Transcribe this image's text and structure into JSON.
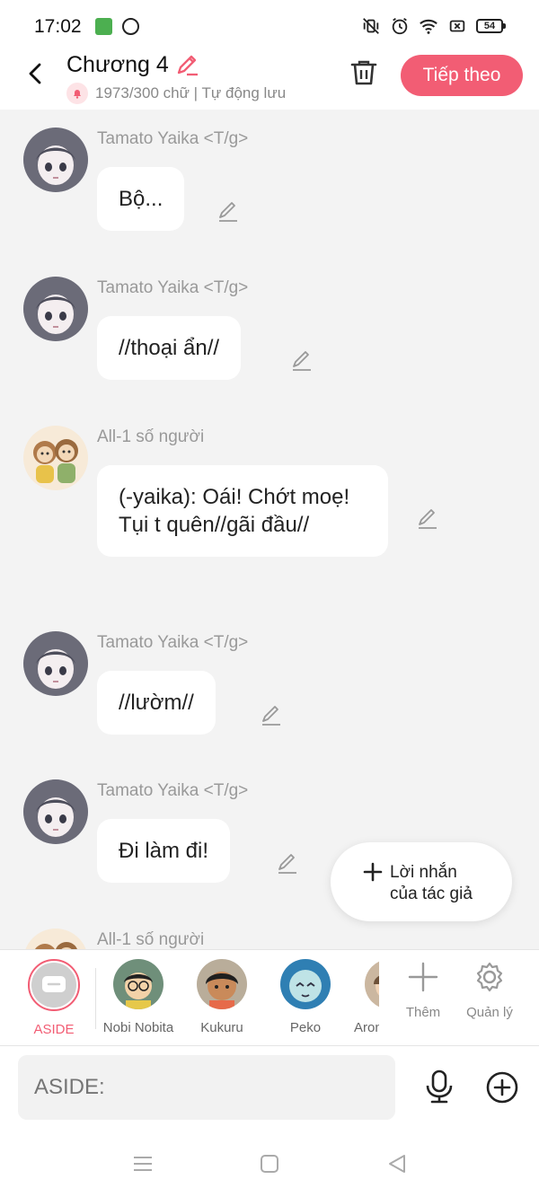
{
  "status_bar": {
    "time": "17:02",
    "battery": "54"
  },
  "header": {
    "title": "Chương 4",
    "subtitle": "1973/300 chữ | Tự động lưu",
    "next_label": "Tiếp theo"
  },
  "messages": [
    {
      "sender": "Tamato Yaika <T/g>",
      "text": "Bộ...",
      "avatar": "anime-girl"
    },
    {
      "sender": "Tamato Yaika <T/g>",
      "text": "//thoại ẩn//",
      "avatar": "anime-girl"
    },
    {
      "sender": "All-1 số người",
      "text": "(-yaika): Oái! Chớt moẹ! Tụi t quên//gãi đầu//",
      "avatar": "monkeys"
    },
    {
      "sender": "Tamato Yaika <T/g>",
      "text": "//lườm//",
      "avatar": "anime-girl"
    },
    {
      "sender": "Tamato Yaika <T/g>",
      "text": "Đi làm đi!",
      "avatar": "anime-girl"
    },
    {
      "sender": "All-1 số người",
      "text": "",
      "avatar": "monkeys"
    }
  ],
  "floating_button": {
    "label_line1": "Lời nhắn",
    "label_line2": "của tác giả"
  },
  "characters": [
    {
      "label": "ASIDE",
      "selected": true
    },
    {
      "label": "Nobi Nobita"
    },
    {
      "label": "Kukuru"
    },
    {
      "label": "Peko"
    },
    {
      "label": "Aron"
    }
  ],
  "tools": {
    "add_label": "Thêm",
    "manage_label": "Quản lý"
  },
  "input": {
    "placeholder": "ASIDE:"
  },
  "colors": {
    "accent": "#f25d74",
    "background": "#f3f3f3"
  }
}
